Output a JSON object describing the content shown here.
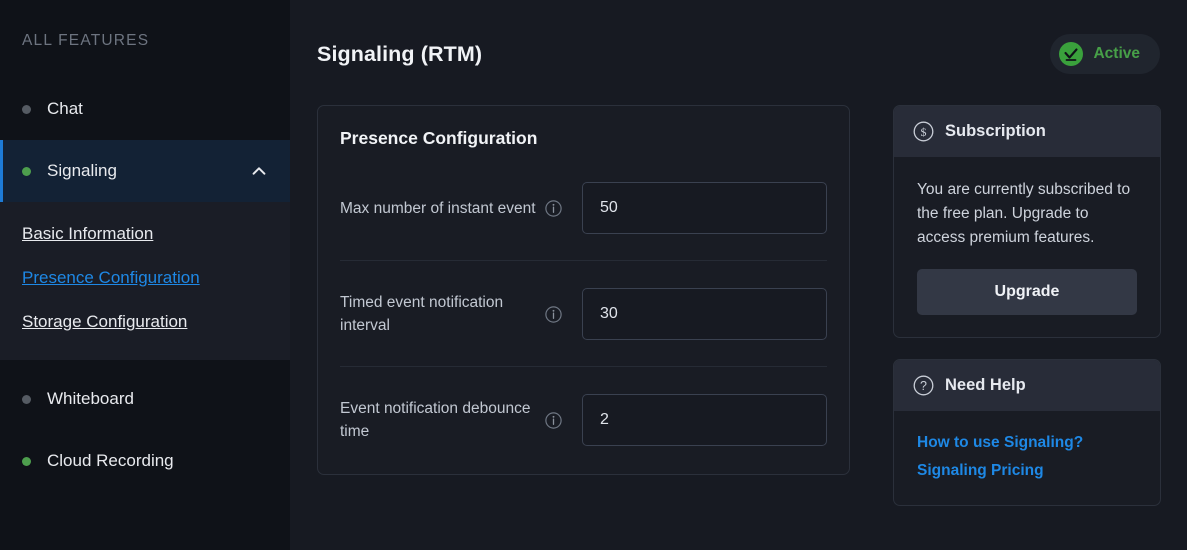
{
  "sidebar": {
    "heading": "ALL FEATURES",
    "items": [
      {
        "label": "Chat",
        "status": "gray",
        "active": false
      },
      {
        "label": "Signaling",
        "status": "green",
        "active": true
      }
    ],
    "submenu": [
      {
        "label": "Basic Information",
        "selected": false
      },
      {
        "label": "Presence Configuration",
        "selected": true
      },
      {
        "label": "Storage Configuration",
        "selected": false
      }
    ],
    "lower_items": [
      {
        "label": "Whiteboard",
        "status": "gray"
      },
      {
        "label": "Cloud Recording",
        "status": "green"
      }
    ]
  },
  "header": {
    "title": "Signaling (RTM)",
    "status_label": "Active",
    "status_color": "#47a048"
  },
  "card": {
    "title": "Presence Configuration",
    "fields": [
      {
        "label": "Max number of instant event",
        "value": "50"
      },
      {
        "label": "Timed event notification interval",
        "value": "30"
      },
      {
        "label": "Event notification debounce time",
        "value": "2"
      }
    ]
  },
  "subscription": {
    "title": "Subscription",
    "text": "You are currently subscribed to the free plan. Upgrade to access premium features.",
    "button_label": "Upgrade"
  },
  "help": {
    "title": "Need Help",
    "links": [
      {
        "label": "How to use Signaling?"
      },
      {
        "label": "Signaling Pricing"
      }
    ]
  },
  "colors": {
    "accent_blue": "#1e88e5",
    "status_green": "#4d9e4d",
    "sidebar_bg": "#0f1218",
    "main_bg": "#171a22",
    "panel_header_bg": "#282c38"
  }
}
